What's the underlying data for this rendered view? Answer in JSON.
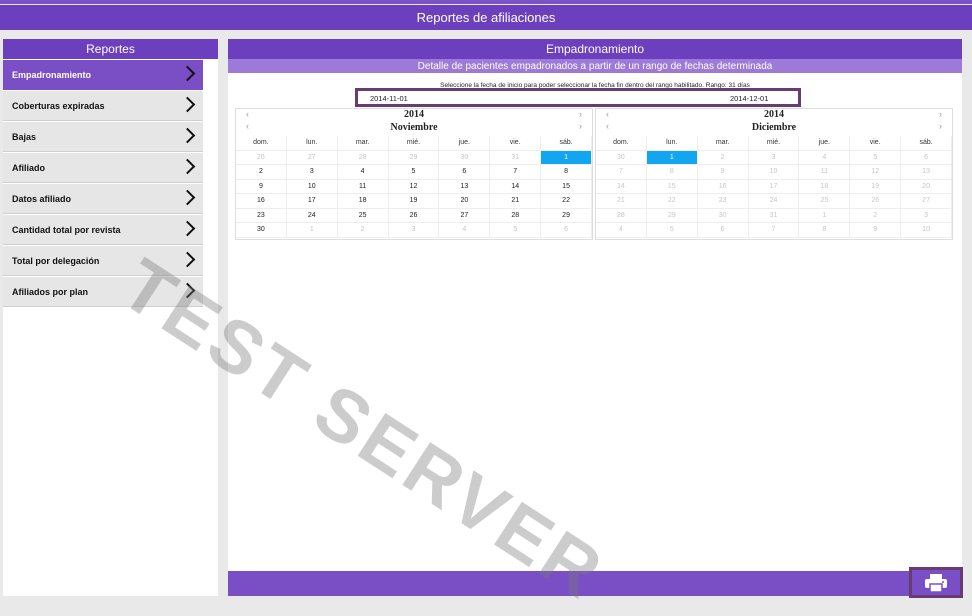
{
  "header": {
    "title": "Reportes de afiliaciones"
  },
  "sidebar": {
    "title": "Reportes",
    "items": [
      {
        "label": "Empadronamiento",
        "active": true
      },
      {
        "label": "Coberturas expiradas"
      },
      {
        "label": "Bajas"
      },
      {
        "label": "Afiliado"
      },
      {
        "label": "Datos afiliado"
      },
      {
        "label": "Cantidad total por revista"
      },
      {
        "label": "Total por delegación"
      },
      {
        "label": "Afiliados por plan"
      }
    ]
  },
  "main": {
    "title": "Empadronamiento",
    "subtitle": "Detalle de pacientes empadronados a partir de un rango de fechas determinada",
    "instruction": "Seleccione la fecha de inicio para poder seleccionar la fecha fin dentro del rango habilitado. Rango: 31 días",
    "start_date": "2014-11-01",
    "end_date": "2014-12-01"
  },
  "calendars": {
    "weekdays": [
      "dom.",
      "lun.",
      "mar.",
      "mié.",
      "jue.",
      "vie.",
      "sáb."
    ],
    "left": {
      "year": "2014",
      "month": "Noviembre",
      "days": [
        "26",
        "27",
        "28",
        "29",
        "30",
        "31",
        "1",
        "2",
        "3",
        "4",
        "5",
        "6",
        "7",
        "8",
        "9",
        "10",
        "11",
        "12",
        "13",
        "14",
        "15",
        "16",
        "17",
        "18",
        "19",
        "20",
        "21",
        "22",
        "23",
        "24",
        "25",
        "26",
        "27",
        "28",
        "29",
        "30",
        "1",
        "2",
        "3",
        "4",
        "5",
        "6"
      ]
    },
    "right": {
      "year": "2014",
      "month": "Diciembre",
      "days": [
        "30",
        "1",
        "2",
        "3",
        "4",
        "5",
        "6",
        "7",
        "8",
        "9",
        "10",
        "11",
        "12",
        "13",
        "14",
        "15",
        "16",
        "17",
        "18",
        "19",
        "20",
        "21",
        "22",
        "23",
        "24",
        "25",
        "26",
        "27",
        "28",
        "29",
        "30",
        "31",
        "1",
        "2",
        "3",
        "4",
        "5",
        "6",
        "7",
        "8",
        "9",
        "10"
      ]
    },
    "nav": {
      "prev": "‹",
      "next": "›"
    }
  },
  "watermark": "TEST SERVER",
  "colors": {
    "header": "#6b3fbd",
    "accent": "#7a4fc6",
    "selected": "#12a6f0"
  },
  "icons": {
    "print": "printer-icon"
  }
}
